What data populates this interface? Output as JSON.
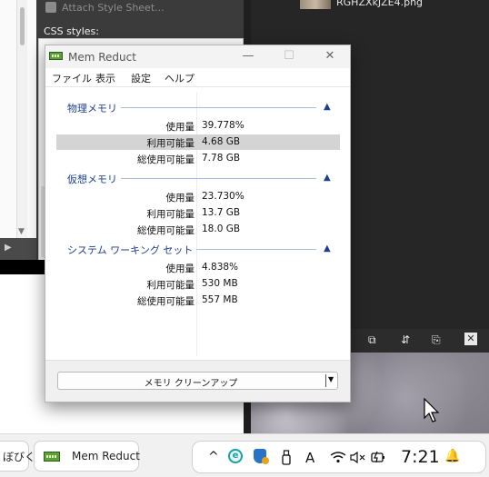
{
  "background": {
    "left_panel": {
      "attach_label": "Attach Style Sheet...",
      "css_styles_label": "CSS styles:"
    },
    "image_viewer": {
      "file_name": "RGHZXkJZE4.png",
      "toolbar_icons": [
        "move-icon",
        "sort-icon",
        "stamp-icon",
        "close-icon"
      ]
    }
  },
  "window": {
    "title": "Mem Reduct",
    "controls": {
      "minimize": "—",
      "maximize": "☐",
      "close": "✕"
    },
    "menu": [
      "ファイル",
      "表示",
      "設定",
      "ヘルプ"
    ],
    "groups": [
      {
        "title": "物理メモリ",
        "rows": [
          {
            "label": "使用量",
            "value": "39.778%",
            "highlight": false
          },
          {
            "label": "利用可能量",
            "value": "4.68 GB",
            "highlight": true
          },
          {
            "label": "総使用可能量",
            "value": "7.78 GB",
            "highlight": false
          }
        ]
      },
      {
        "title": "仮想メモリ",
        "rows": [
          {
            "label": "使用量",
            "value": "23.730%",
            "highlight": false
          },
          {
            "label": "利用可能量",
            "value": "13.7 GB",
            "highlight": false
          },
          {
            "label": "総使用可能量",
            "value": "18.0 GB",
            "highlight": false
          }
        ]
      },
      {
        "title": "システム ワーキング セット",
        "rows": [
          {
            "label": "使用量",
            "value": "4.838%",
            "highlight": false
          },
          {
            "label": "利用可能量",
            "value": "530 MB",
            "highlight": false
          },
          {
            "label": "総使用可能量",
            "value": "557 MB",
            "highlight": false
          }
        ]
      }
    ],
    "clean_button": "メモリ クリーンアップ"
  },
  "taskbar": {
    "partial_app": "ぼびく",
    "active_app": "Mem Reduct",
    "tray": {
      "chevron": "^",
      "ime": "A",
      "time": "7:21"
    }
  },
  "colors": {
    "group_title": "#1e3f8a",
    "group_line": "#a7bedf",
    "highlight_row": "#d4d4d4",
    "app_icon_green": "#5a9f3a"
  }
}
